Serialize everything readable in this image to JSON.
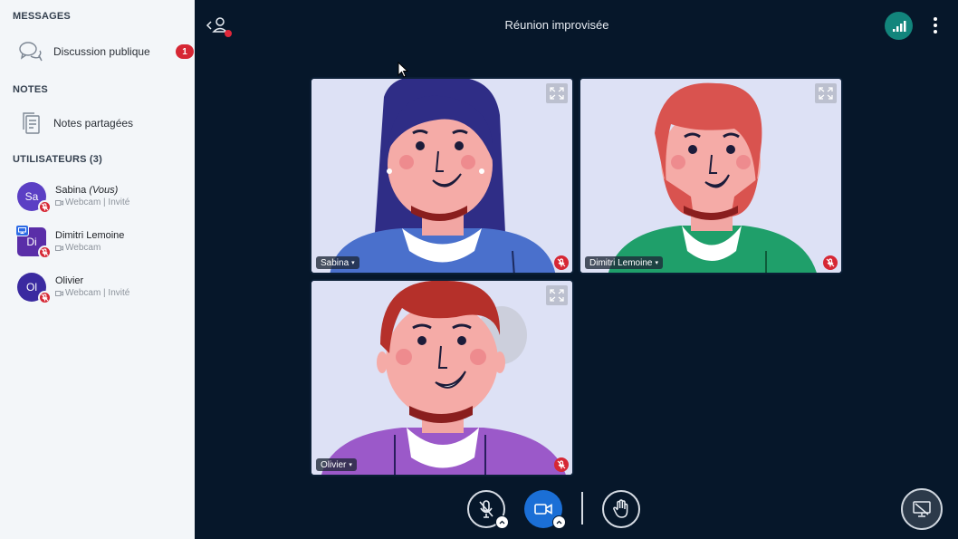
{
  "sidebar": {
    "messages_title": "MESSAGES",
    "public_chat_label": "Discussion publique",
    "public_chat_unread": "1",
    "notes_title": "NOTES",
    "shared_notes_label": "Notes partagées",
    "users_title": "UTILISATEURS (3)",
    "users": [
      {
        "initials": "Sa",
        "name": "Sabina",
        "you_tag": "(Vous)",
        "status": "Webcam | Invité",
        "avatar_color": "#5b3fc4"
      },
      {
        "initials": "Di",
        "name": "Dimitri Lemoine",
        "you_tag": "",
        "status": "Webcam",
        "avatar_color": "#5a2ea8"
      },
      {
        "initials": "Ol",
        "name": "Olivier",
        "you_tag": "",
        "status": "Webcam | Invité",
        "avatar_color": "#3a2aa0"
      }
    ]
  },
  "header": {
    "meeting_title": "Réunion improvisée"
  },
  "videos": [
    {
      "name": "Sabina"
    },
    {
      "name": "Dimitri Lemoine"
    },
    {
      "name": "Olivier"
    }
  ],
  "colors": {
    "accent": "#1b6fd6",
    "danger": "#d62734",
    "connection": "#12857c",
    "background": "#06172a",
    "sidebar": "#f3f6f9"
  }
}
